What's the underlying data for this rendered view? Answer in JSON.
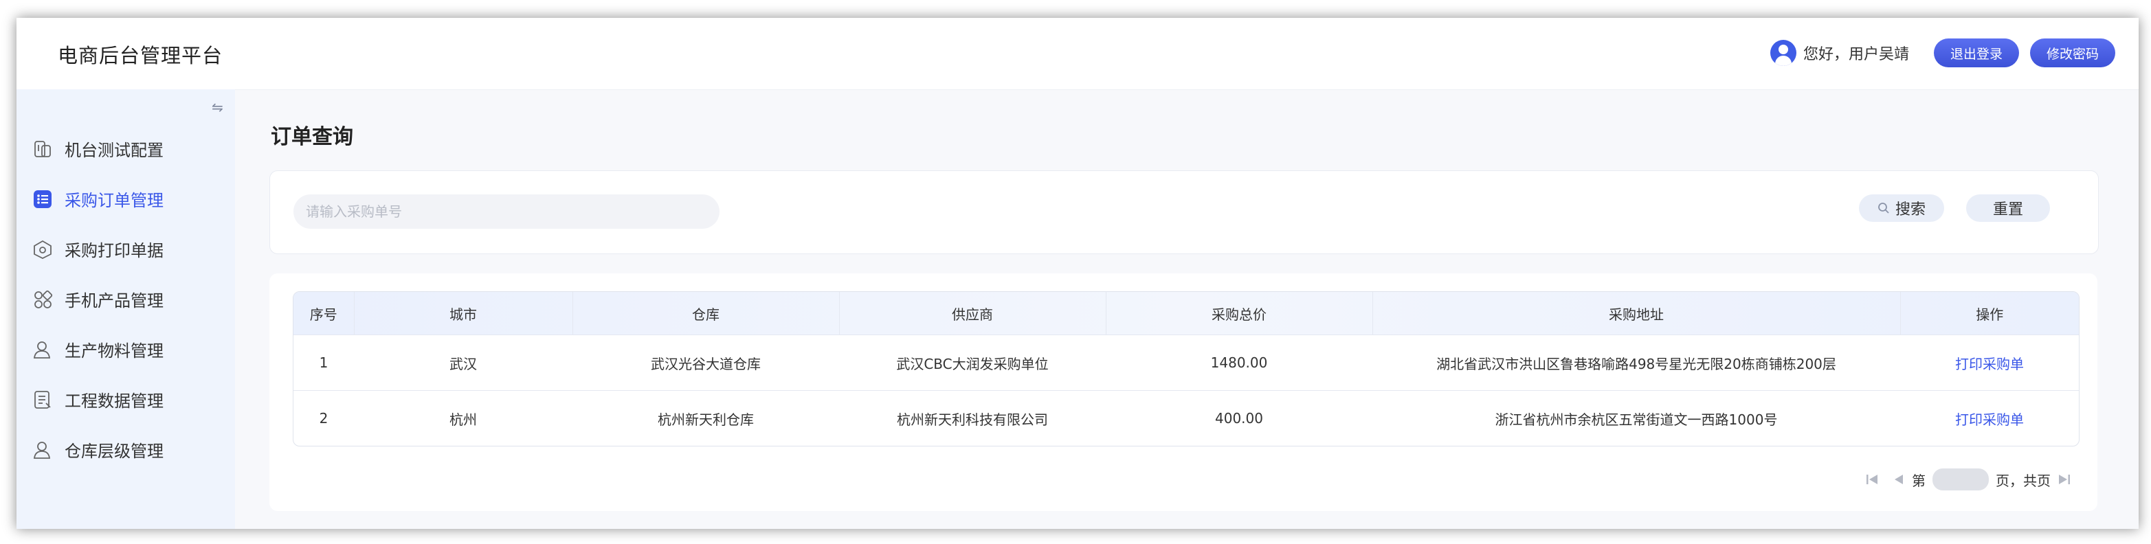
{
  "header": {
    "app_title": "电商后台管理平台",
    "greeting": "您好，用户吴靖",
    "logout_label": "退出登录",
    "change_password_label": "修改密码"
  },
  "sidebar": {
    "collapse_glyph": "⇋",
    "items": [
      {
        "label": "机台测试配置",
        "icon": "device-config-icon",
        "active": false
      },
      {
        "label": "采购订单管理",
        "icon": "order-list-icon",
        "active": true
      },
      {
        "label": "采购打印单据",
        "icon": "print-doc-icon",
        "active": false
      },
      {
        "label": "手机产品管理",
        "icon": "grid-product-icon",
        "active": false
      },
      {
        "label": "生产物料管理",
        "icon": "user-material-icon",
        "active": false
      },
      {
        "label": "工程数据管理",
        "icon": "document-icon",
        "active": false
      },
      {
        "label": "仓库层级管理",
        "icon": "user-warehouse-icon",
        "active": false
      }
    ]
  },
  "main": {
    "page_title": "订单查询",
    "search": {
      "placeholder": "请输入采购单号",
      "value": "",
      "search_label": "搜索",
      "reset_label": "重置"
    },
    "table": {
      "columns": [
        "序号",
        "城市",
        "仓库",
        "供应商",
        "采购总价",
        "采购地址",
        "操作"
      ],
      "rows": [
        [
          "1",
          "武汉",
          "武汉光谷大道仓库",
          "武汉CBC大润发采购单位",
          "1480.00",
          "湖北省武汉市洪山区鲁巷珞喻路498号星光无限20栋商铺栋200层",
          "打印采购单"
        ],
        [
          "2",
          "杭州",
          "杭州新天利仓库",
          "杭州新天利科技有限公司",
          "400.00",
          "浙江省杭州市余杭区五常街道文一西路1000号",
          "打印采购单"
        ]
      ]
    },
    "pagination": {
      "page_prefix": "第",
      "page_suffix": "页，共页",
      "page_value": ""
    }
  },
  "colors": {
    "accent": "#3a57e8",
    "sidebar_bg": "#eff4fd",
    "content_bg": "#f7f8fb"
  }
}
